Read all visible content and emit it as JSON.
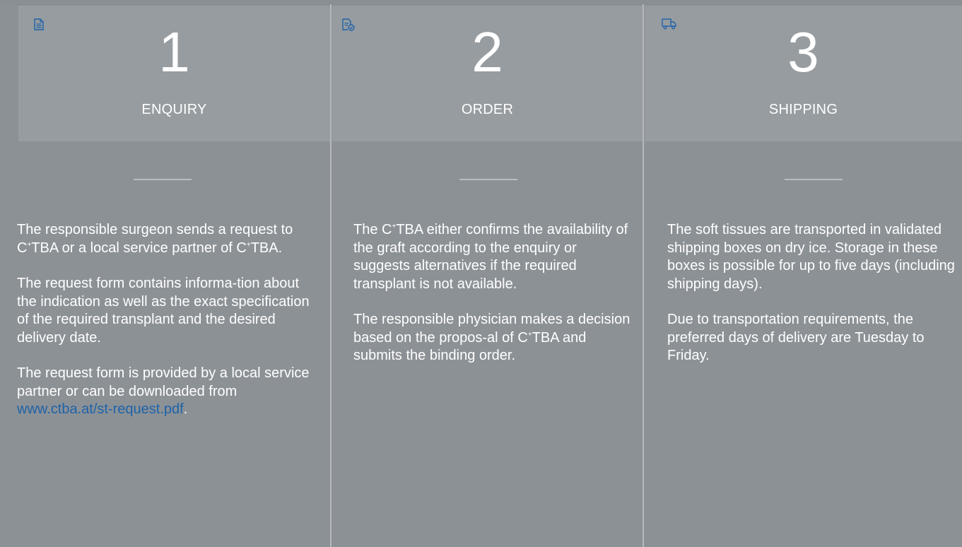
{
  "steps": [
    {
      "icon": "document-icon",
      "number": "1",
      "title": "ENQUIRY",
      "paragraphs": [
        "The responsible surgeon sends a request to C⁺TBA or a local service partner of C⁺TBA.",
        "The request form contains informa-tion about the indication as well as the exact specification of the required transplant and the desired delivery date."
      ],
      "last_paragraph_text": "The request form is provided by a local service partner or can be downloaded from",
      "link_text": "www.ctba.at/st-request.pdf",
      "link_suffix": "."
    },
    {
      "icon": "document-check-icon",
      "number": "2",
      "title": "ORDER",
      "paragraphs": [
        "The C⁺TBA either confirms the availability of the graft according to the enquiry or suggests alternatives if the required transplant is not available.",
        "The responsible physician makes a decision based on the propos-al of C⁺TBA and submits the binding order."
      ]
    },
    {
      "icon": "truck-icon",
      "number": "3",
      "title": "SHIPPING",
      "paragraphs": [
        "The soft tissues are transported in validated shipping boxes on dry ice. Storage in these boxes is possible for up to five days (including shipping days).",
        "Due to transportation requirements, the preferred days of delivery are Tuesday to Friday."
      ]
    }
  ],
  "colors": {
    "background": "#8c9196",
    "header_background": "#979ca0",
    "divider": "#b6babe",
    "text": "#ffffff",
    "link": "#1e63a8",
    "icon": "#1e63a8"
  }
}
